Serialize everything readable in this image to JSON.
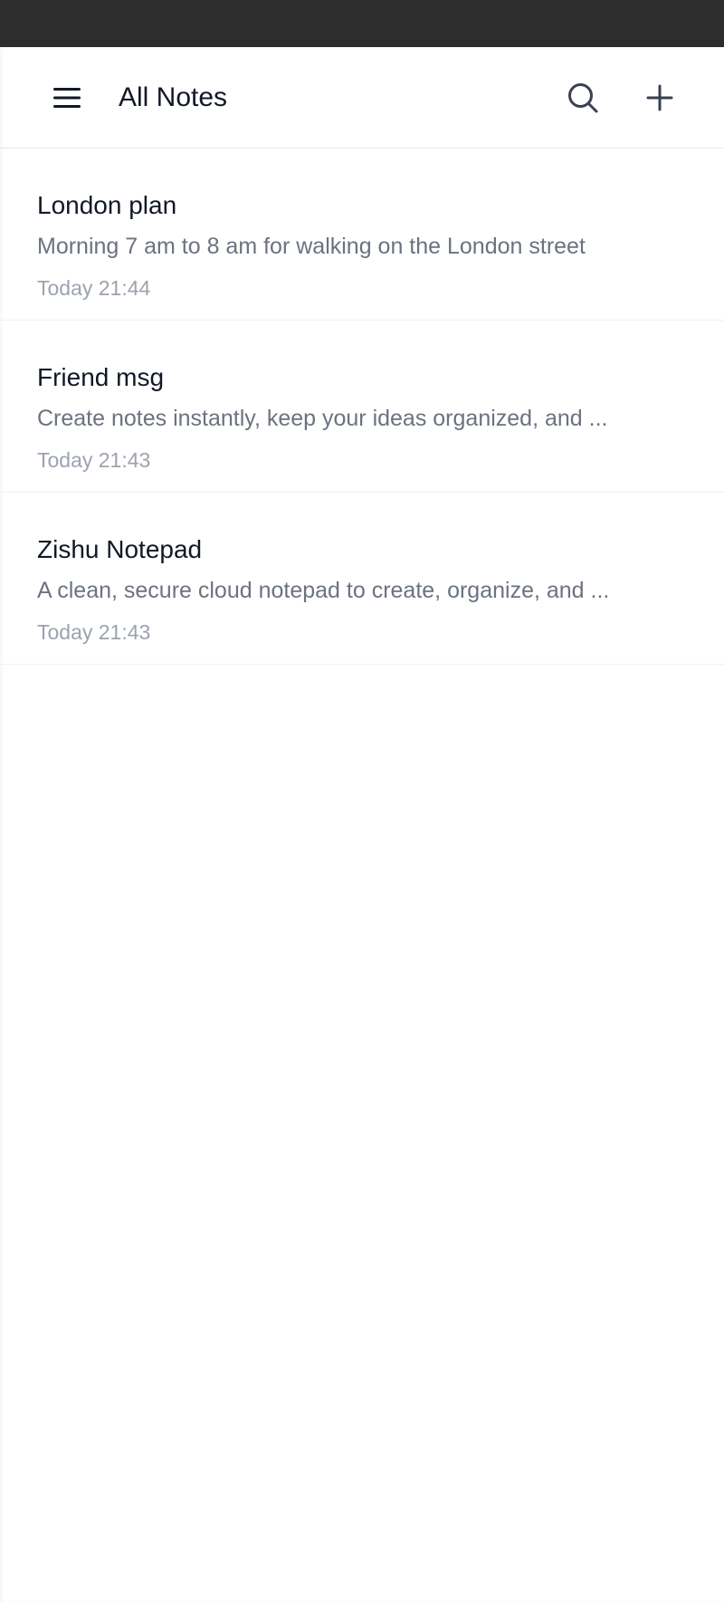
{
  "header": {
    "title": "All Notes",
    "menu_icon": "hamburger-menu-icon",
    "search_icon": "search-icon",
    "add_icon": "plus-icon"
  },
  "notes": [
    {
      "title": "London plan",
      "preview": "Morning 7 am to 8 am for walking on the London street",
      "time": "Today 21:44"
    },
    {
      "title": "Friend msg",
      "preview": "Create notes instantly, keep your ideas organized, and ...",
      "time": "Today 21:43"
    },
    {
      "title": "Zishu Notepad",
      "preview": "A clean, secure cloud notepad to create, organize, and ...",
      "time": "Today 21:43"
    }
  ],
  "colors": {
    "status_bar": "#2d2d2d",
    "title_text": "#111827",
    "preview_text": "#6b7280",
    "time_text": "#9ca3af",
    "divider": "#e5e7eb"
  }
}
